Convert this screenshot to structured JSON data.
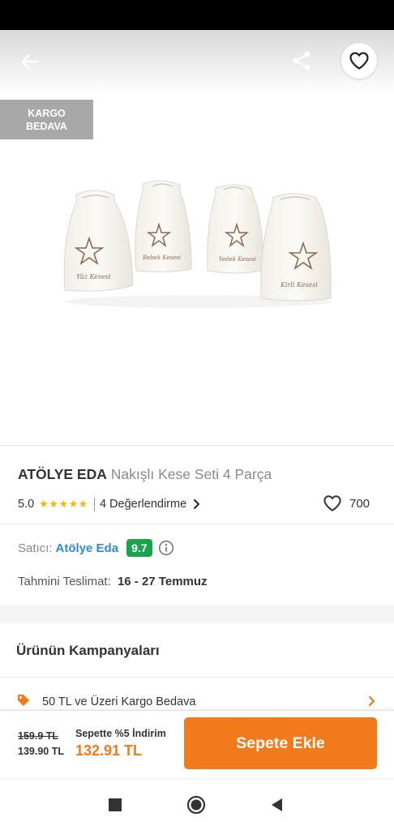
{
  "header": {
    "back_icon": "arrow-left-icon",
    "share_icon": "share-icon",
    "favorite_icon": "heart-outline-icon"
  },
  "badge": {
    "line1": "KARGO",
    "line2": "BEDAVA"
  },
  "bag_texts": [
    "Yüz Kesesi",
    "Bebek Kesesi",
    "Yedek Kesesi",
    "Kirli Kesesi"
  ],
  "product": {
    "brand": "ATÖLYE EDA",
    "name": "Nakışlı Kese Seti 4 Parça",
    "rating": "5.0",
    "stars": "★★★★★",
    "star_count": 5,
    "reviews": "4 Değerlendirme",
    "favorites": "700"
  },
  "seller": {
    "label": "Satıcı:",
    "name": "Atölye Eda",
    "score": "9.7"
  },
  "delivery": {
    "label": "Tahmini Teslimat:",
    "value": "16 - 27 Temmuz"
  },
  "campaigns": {
    "title": "Ürünün Kampanyaları",
    "items": [
      {
        "text": "50 TL ve Üzeri Kargo Bedava",
        "icon": "tag-icon"
      }
    ]
  },
  "pricing": {
    "old_price": "159.9 TL",
    "price": "139.90 TL",
    "discount_label": "Sepette %5 İndirim",
    "cart_price": "132.91 TL",
    "add_to_cart": "Sepete Ekle"
  },
  "nav": {
    "recents_icon": "square-icon",
    "home_icon": "circle-icon",
    "back_icon": "triangle-back-icon"
  },
  "colors": {
    "accent": "#f27a1a",
    "seller_link": "#2f8bd4",
    "score_badge": "#19a44c",
    "stars": "#f8b600",
    "badge_bg": "#a8a8a8"
  }
}
